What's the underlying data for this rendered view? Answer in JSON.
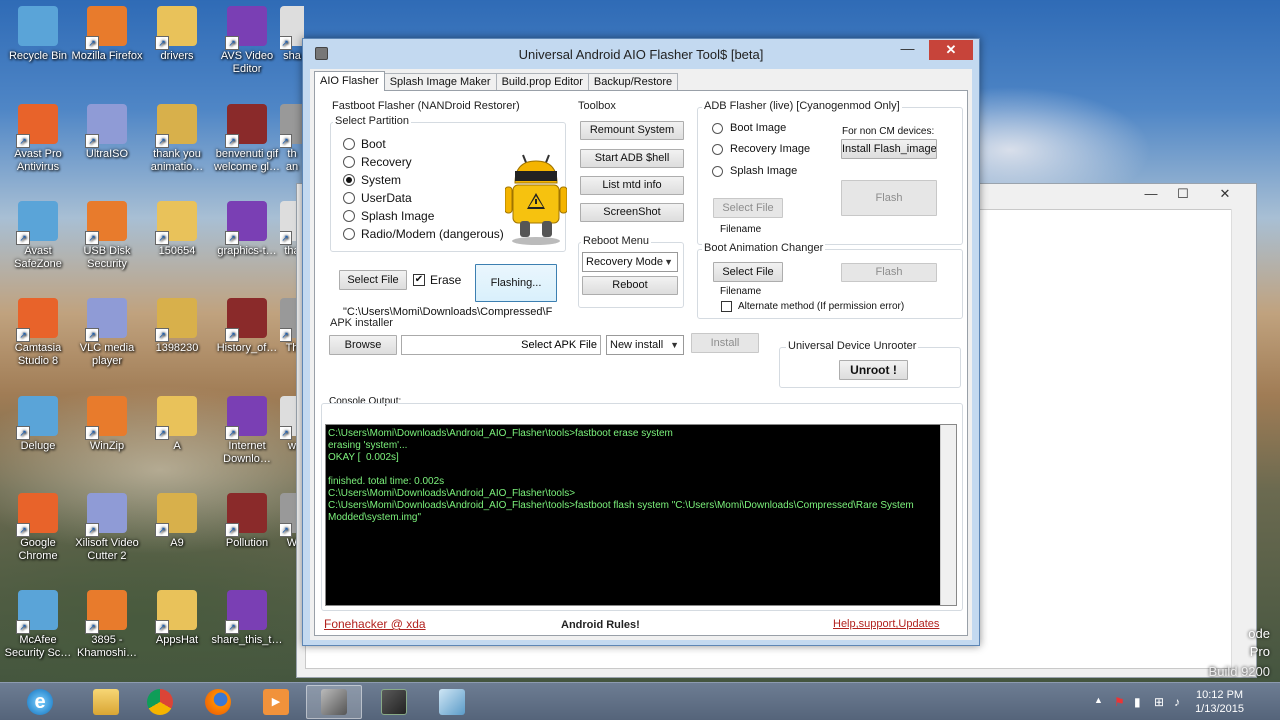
{
  "desktop": {
    "icons": [
      {
        "label": "Recycle Bin"
      },
      {
        "label": "Mozilla Firefox"
      },
      {
        "label": "drivers"
      },
      {
        "label": "AVS Video Editor"
      },
      {
        "label": "sha"
      },
      {
        "label": "Avast Pro Antivirus"
      },
      {
        "label": "UltraISO"
      },
      {
        "label": "thank you animatio…"
      },
      {
        "label": "benvenuti gif welcome gl…"
      },
      {
        "label": "th an"
      },
      {
        "label": "Avast SafeZone"
      },
      {
        "label": "USB Disk Security"
      },
      {
        "label": "150654"
      },
      {
        "label": "graphics-t…"
      },
      {
        "label": "tha"
      },
      {
        "label": "Camtasia Studio 8"
      },
      {
        "label": "VLC media player"
      },
      {
        "label": "1398230"
      },
      {
        "label": "History_of…"
      },
      {
        "label": "Th"
      },
      {
        "label": "Deluge"
      },
      {
        "label": "WinZip"
      },
      {
        "label": "A"
      },
      {
        "label": "Internet Downlo…"
      },
      {
        "label": "w"
      },
      {
        "label": "Google Chrome"
      },
      {
        "label": "Xilisoft Video Cutter 2"
      },
      {
        "label": "A9"
      },
      {
        "label": "Pollution"
      },
      {
        "label": "W"
      },
      {
        "label": "McAfee Security Sc…"
      },
      {
        "label": "3895 - Khamoshi…"
      },
      {
        "label": "AppsHat"
      },
      {
        "label": "share_this_t…"
      }
    ],
    "bg_text": [
      "ode",
      "Pro",
      "Build 9200"
    ]
  },
  "window": {
    "title": "Universal Android AIO Flasher Tool$ [beta]",
    "close_glyph": "✕",
    "min_glyph": "—",
    "max_glyph": "☐"
  },
  "tabs": [
    "AIO Flasher",
    "Splash Image Maker",
    "Build.prop Editor",
    "Backup/Restore"
  ],
  "fastboot": {
    "group_title": "Fastboot Flasher (NANDroid Restorer)",
    "partition_title": "Select Partition",
    "partitions": [
      "Boot",
      "Recovery",
      "System",
      "UserData",
      "Splash Image",
      "Radio/Modem (dangerous)"
    ],
    "selected_partition": "System",
    "select_file_label": "Select File",
    "erase_label": "Erase",
    "erase_checked": true,
    "flashing_label": "Flashing...",
    "file_path": "\"C:\\Users\\Momi\\Downloads\\Compressed\\F"
  },
  "toolbox": {
    "title": "Toolbox",
    "buttons": [
      "Remount System",
      "Start ADB $hell",
      "List mtd info",
      "ScreenShot"
    ],
    "reboot_title": "Reboot Menu",
    "reboot_mode": "Recovery Mode",
    "reboot_label": "Reboot"
  },
  "adb": {
    "title": "ADB Flasher (live) [Cyanogenmod Only]",
    "options": [
      "Boot Image",
      "Recovery Image",
      "Splash Image"
    ],
    "non_cm_label": "For non CM devices:",
    "install_label": "Install Flash_image",
    "select_file_label": "Select File",
    "filename_label": "Filename",
    "flash_label": "Flash"
  },
  "boot_anim": {
    "title": "Boot Animation Changer",
    "select_file_label": "Select File",
    "flash_label": "Flash",
    "filename_label": "Filename",
    "alternate_label": "Alternate method (If permission error)"
  },
  "apk": {
    "title": "APK installer",
    "browse_label": "Browse",
    "select_apk_label": "Select APK File",
    "install_mode": "New install",
    "install_label": "Install"
  },
  "unrooter": {
    "title": "Universal Device Unrooter",
    "button_label": "Unroot !"
  },
  "console": {
    "title": "Console Output:",
    "lines": [
      "C:\\Users\\Momi\\Downloads\\Android_AIO_Flasher\\tools>fastboot erase system",
      "erasing 'system'...",
      "OKAY [  0.002s]",
      "",
      "finished. total time: 0.002s",
      "C:\\Users\\Momi\\Downloads\\Android_AIO_Flasher\\tools>",
      "C:\\Users\\Momi\\Downloads\\Android_AIO_Flasher\\tools>fastboot flash system \"C:\\Users\\Momi\\Downloads\\Compressed\\Rare System Modded\\system.img\""
    ]
  },
  "footer": {
    "credit": "Fonehacker @ xda",
    "tagline": "Android Rules!",
    "help": "Help,support,Updates"
  },
  "taskbar": {
    "time": "10:12 PM",
    "date": "1/13/2015"
  }
}
